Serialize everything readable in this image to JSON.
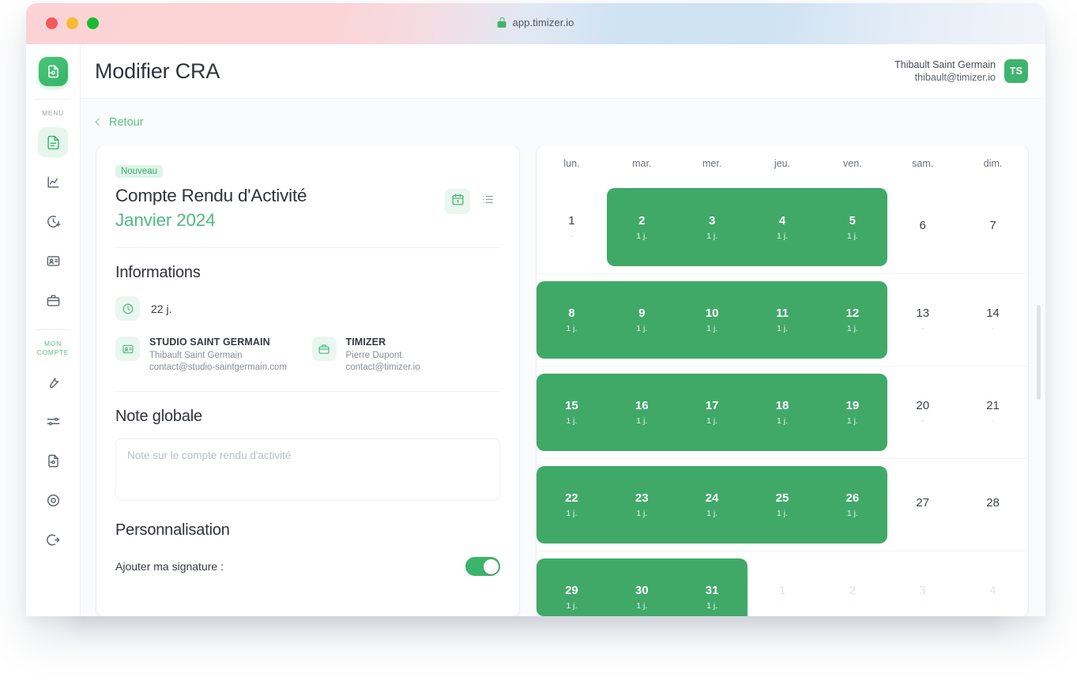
{
  "browser": {
    "url": "app.timizer.io",
    "lock_icon": "lock-icon",
    "traffic_lights": [
      "close",
      "minimize",
      "maximize"
    ]
  },
  "sidebar": {
    "logo_icon": "document-logo-icon",
    "menu_label": "MENU",
    "account_label_line1": "MON",
    "account_label_line2": "COMPTE",
    "menu_items": [
      {
        "icon": "document-icon",
        "name": "sidebar-item-cra",
        "active": true
      },
      {
        "icon": "chart-icon",
        "name": "sidebar-item-statistiques",
        "active": false
      },
      {
        "icon": "clock-plus-icon",
        "name": "sidebar-item-temps",
        "active": false
      },
      {
        "icon": "contact-card-icon",
        "name": "sidebar-item-clients",
        "active": false
      },
      {
        "icon": "briefcase-icon",
        "name": "sidebar-item-missions",
        "active": false
      }
    ],
    "account_items": [
      {
        "icon": "wrench-icon",
        "name": "sidebar-item-parametres"
      },
      {
        "icon": "sliders-icon",
        "name": "sidebar-item-preferences"
      },
      {
        "icon": "file-icon",
        "name": "sidebar-item-documents"
      },
      {
        "icon": "lifebuoy-icon",
        "name": "sidebar-item-aide"
      },
      {
        "icon": "logout-icon",
        "name": "sidebar-item-deconnexion"
      }
    ]
  },
  "topbar": {
    "title": "Modifier CRA",
    "user_name": "Thibault Saint Germain",
    "user_email": "thibault@timizer.io",
    "avatar_initials": "TS"
  },
  "back": {
    "label": "Retour",
    "icon": "chevron-left-icon"
  },
  "cra": {
    "badge": "Nouveau",
    "title": "Compte Rendu d'Activité",
    "month": "Janvier 2024",
    "view_calendar_icon": "calendar-icon",
    "view_list_icon": "list-icon",
    "informations_title": "Informations",
    "days_total": "22 j.",
    "clock_icon": "clock-icon",
    "contacts": [
      {
        "icon": "contact-card-icon",
        "company": "STUDIO SAINT GERMAIN",
        "person": "Thibault Saint Germain",
        "email": "contact@studio-saintgermain.com"
      },
      {
        "icon": "briefcase-icon",
        "company": "TIMIZER",
        "person": "Pierre Dupont",
        "email": "contact@timizer.io"
      }
    ],
    "note_title": "Note globale",
    "note_value": "",
    "note_placeholder": "Note sur le compte rendu d'activité",
    "personnalisation_title": "Personnalisation",
    "signature_label": "Ajouter ma signature :",
    "signature_enabled": true
  },
  "calendar": {
    "weekdays": [
      "lun.",
      "mar.",
      "mer.",
      "jeu.",
      "ven.",
      "sam.",
      "dim."
    ],
    "day_unit": "1 j.",
    "empty_unit": "-",
    "rows": [
      {
        "days": [
          {
            "num": "1",
            "sub": "-",
            "state": "plain"
          },
          {
            "num": "2",
            "sub": "1 j.",
            "state": "selected"
          },
          {
            "num": "3",
            "sub": "1 j.",
            "state": "selected"
          },
          {
            "num": "4",
            "sub": "1 j.",
            "state": "selected"
          },
          {
            "num": "5",
            "sub": "1 j.",
            "state": "selected"
          },
          {
            "num": "6",
            "sub": "",
            "state": "plain"
          },
          {
            "num": "7",
            "sub": "",
            "state": "plain"
          }
        ],
        "selection": {
          "start": 1,
          "end": 4
        }
      },
      {
        "days": [
          {
            "num": "8",
            "sub": "1 j.",
            "state": "selected"
          },
          {
            "num": "9",
            "sub": "1 j.",
            "state": "selected"
          },
          {
            "num": "10",
            "sub": "1 j.",
            "state": "selected"
          },
          {
            "num": "11",
            "sub": "1 j.",
            "state": "selected"
          },
          {
            "num": "12",
            "sub": "1 j.",
            "state": "selected"
          },
          {
            "num": "13",
            "sub": "-",
            "state": "plain"
          },
          {
            "num": "14",
            "sub": "-",
            "state": "plain"
          }
        ],
        "selection": {
          "start": 0,
          "end": 4
        }
      },
      {
        "days": [
          {
            "num": "15",
            "sub": "1 j.",
            "state": "selected"
          },
          {
            "num": "16",
            "sub": "1 j.",
            "state": "selected"
          },
          {
            "num": "17",
            "sub": "1 j.",
            "state": "selected"
          },
          {
            "num": "18",
            "sub": "1 j.",
            "state": "selected"
          },
          {
            "num": "19",
            "sub": "1 j.",
            "state": "selected"
          },
          {
            "num": "20",
            "sub": "-",
            "state": "plain"
          },
          {
            "num": "21",
            "sub": "-",
            "state": "plain"
          }
        ],
        "selection": {
          "start": 0,
          "end": 4
        }
      },
      {
        "days": [
          {
            "num": "22",
            "sub": "1 j.",
            "state": "selected"
          },
          {
            "num": "23",
            "sub": "1 j.",
            "state": "selected"
          },
          {
            "num": "24",
            "sub": "1 j.",
            "state": "selected"
          },
          {
            "num": "25",
            "sub": "1 j.",
            "state": "selected"
          },
          {
            "num": "26",
            "sub": "1 j.",
            "state": "selected"
          },
          {
            "num": "27",
            "sub": "",
            "state": "plain"
          },
          {
            "num": "28",
            "sub": "",
            "state": "plain"
          }
        ],
        "selection": {
          "start": 0,
          "end": 4
        }
      },
      {
        "days": [
          {
            "num": "29",
            "sub": "1 j.",
            "state": "selected"
          },
          {
            "num": "30",
            "sub": "1 j.",
            "state": "selected"
          },
          {
            "num": "31",
            "sub": "1 j.",
            "state": "selected"
          },
          {
            "num": "1",
            "sub": "-",
            "state": "outside"
          },
          {
            "num": "2",
            "sub": "-",
            "state": "outside"
          },
          {
            "num": "3",
            "sub": "-",
            "state": "outside"
          },
          {
            "num": "4",
            "sub": "-",
            "state": "outside"
          }
        ],
        "selection": {
          "start": 0,
          "end": 2
        }
      }
    ]
  },
  "colors": {
    "brand_green": "#3cb46c",
    "selection_green": "#40a968",
    "accent_green_text": "#4fba82",
    "title_dark": "#2f333a",
    "muted": "#878e98"
  }
}
